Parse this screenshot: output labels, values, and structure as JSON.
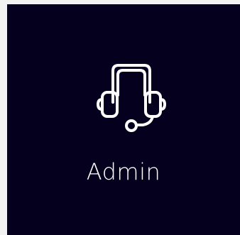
{
  "tile": {
    "label": "Admin",
    "icon": "headset-icon"
  },
  "colors": {
    "tile_background": "#06001f",
    "page_background": "#f2f2f2",
    "foreground": "#ffffff"
  }
}
